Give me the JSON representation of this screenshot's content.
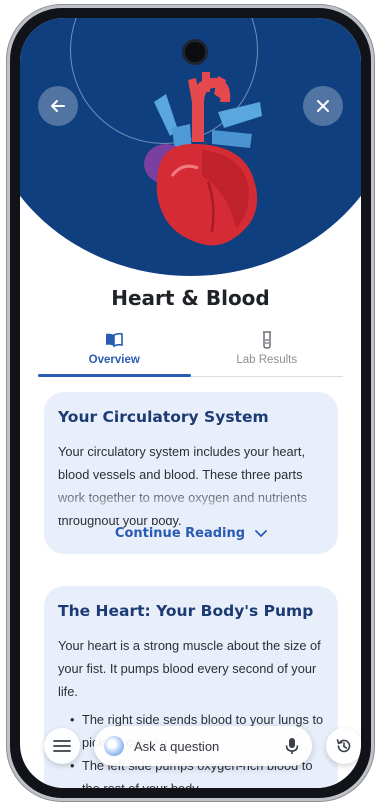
{
  "page": {
    "title": "Heart & Blood"
  },
  "header": {
    "back_icon": "arrow-left-icon",
    "close_icon": "close-icon",
    "hero_image": "heart-illustration",
    "hero_color": "#0f3f7e"
  },
  "tabs": [
    {
      "label": "Overview",
      "icon": "book-open-icon",
      "active": true
    },
    {
      "label": "Lab Results",
      "icon": "test-tube-icon",
      "active": false
    }
  ],
  "cards": [
    {
      "title": "Your Circulatory System",
      "body": "Your circulatory system includes your heart, blood vessels and blood. These three parts work together to move oxygen and nutrients throughout your body.",
      "action_label": "Continue Reading"
    },
    {
      "title": "The Heart: Your Body's Pump",
      "body": "Your heart is a strong muscle about the size of your fist. It pumps blood every second of your life.",
      "bullets": [
        "The right side sends blood to your lungs to pick up oxygen",
        "The left side pumps oxygen-rich blood to the rest of your body"
      ]
    }
  ],
  "bottom_bar": {
    "menu_icon": "menu-icon",
    "ask_placeholder": "Ask a question",
    "mic_icon": "microphone-icon",
    "history_icon": "history-icon"
  },
  "colors": {
    "accent": "#2a5bb3",
    "card_bg": "#e8effb",
    "card_title": "#1d3b73"
  }
}
